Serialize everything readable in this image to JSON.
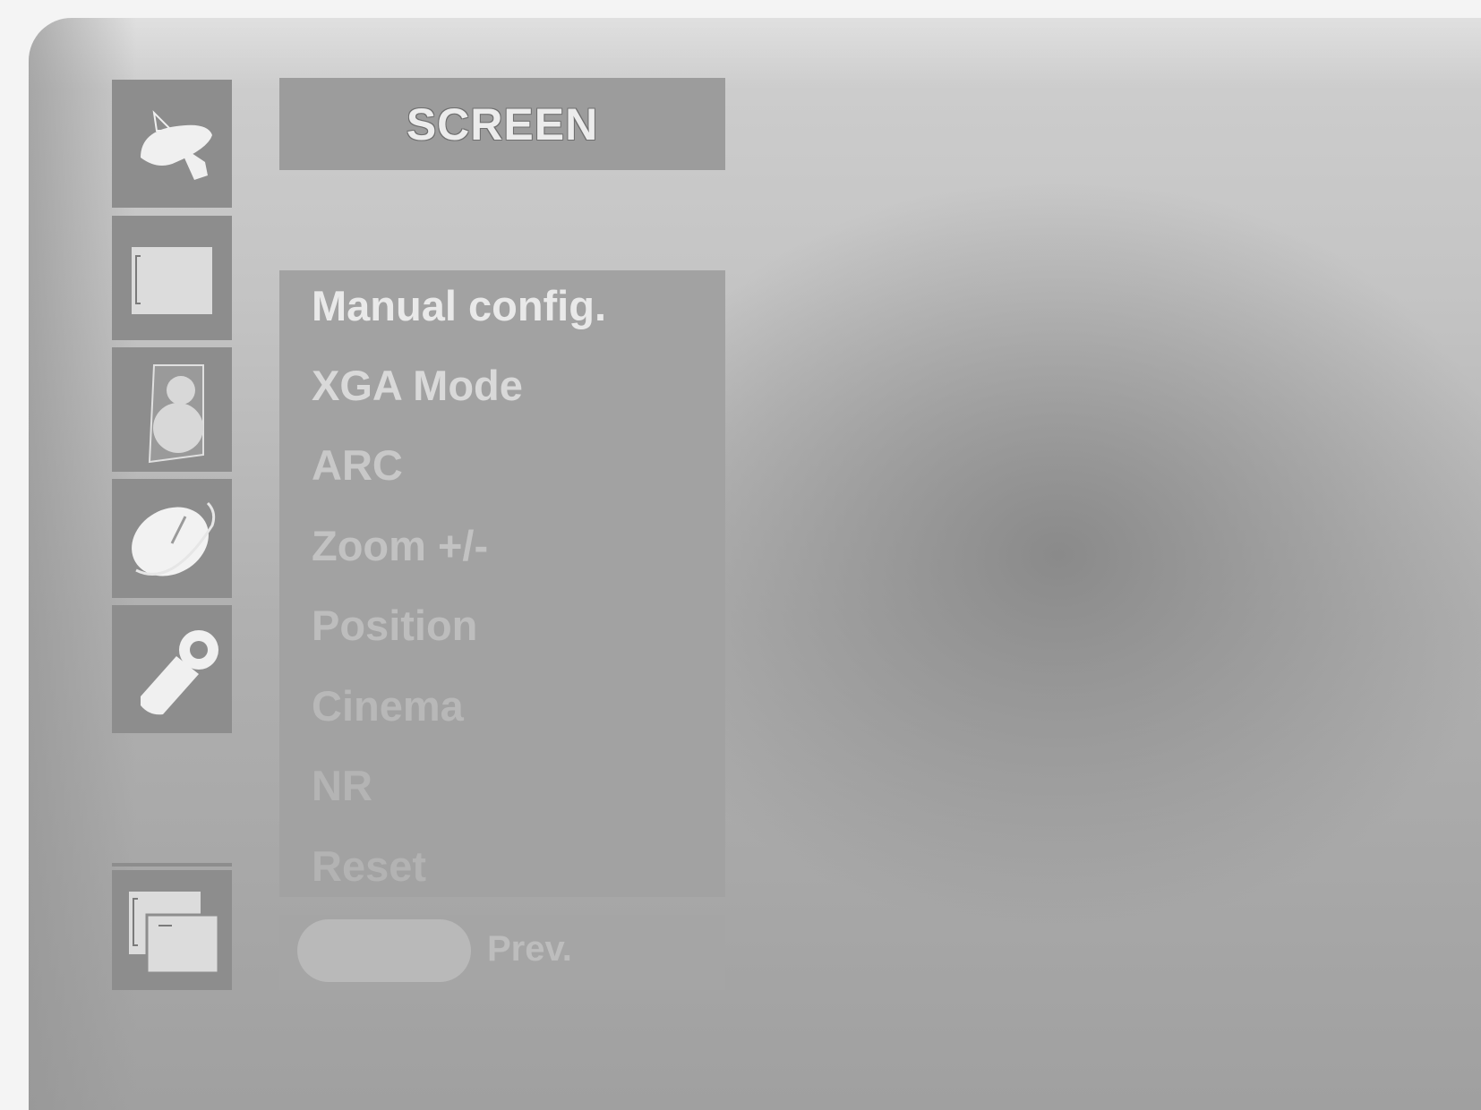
{
  "title": "SCREEN",
  "sidebar": {
    "icons": [
      {
        "name": "satellite-dish-icon"
      },
      {
        "name": "picture-icon"
      },
      {
        "name": "audio-speaker-icon"
      },
      {
        "name": "clock-icon"
      },
      {
        "name": "wrench-icon"
      },
      {
        "name": "pip-icon"
      }
    ]
  },
  "menu": {
    "items": [
      {
        "label": "Manual config.",
        "color": "#e9e9e9"
      },
      {
        "label": "XGA Mode",
        "color": "#d9d9d9"
      },
      {
        "label": "ARC",
        "color": "#c8c8c8"
      },
      {
        "label": "Zoom +/-",
        "color": "#c2c2c2"
      },
      {
        "label": "Position",
        "color": "#bdbdbd"
      },
      {
        "label": "Cinema",
        "color": "#b8b8b8"
      },
      {
        "label": "NR",
        "color": "#b4b4b4"
      },
      {
        "label": "Reset",
        "color": "#b3b3b3"
      }
    ]
  },
  "nav": {
    "prev_label": "Prev."
  },
  "colors": {
    "tile": "#8d8d8d",
    "panel": "#a2a2a2",
    "title_bar": "#9c9c9c"
  }
}
